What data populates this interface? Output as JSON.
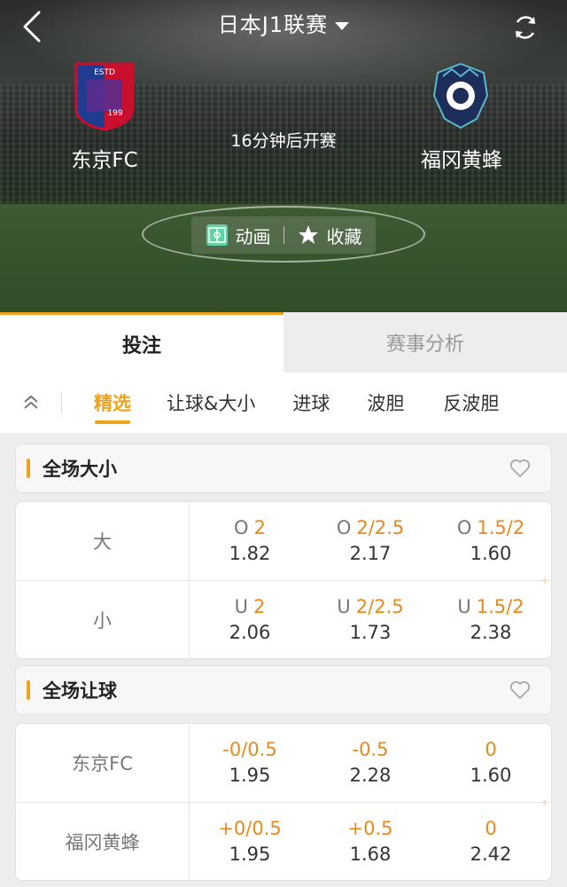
{
  "header": {
    "league": "日本J1联赛",
    "kickoff": "16分钟后开赛",
    "home_team": "东京FC",
    "away_team": "福冈黄蜂",
    "actions": {
      "animation": "动画",
      "favorite": "收藏"
    }
  },
  "main_tabs": [
    "投注",
    "赛事分析"
  ],
  "sub_tabs": [
    "精选",
    "让球&大小",
    "进球",
    "波胆",
    "反波胆"
  ],
  "sections": [
    {
      "title": "全场大小",
      "rows": [
        {
          "label": "大",
          "cells": [
            {
              "prefix": "O",
              "line": "2",
              "price": "1.82"
            },
            {
              "prefix": "O",
              "line": "2/2.5",
              "price": "2.17"
            },
            {
              "prefix": "O",
              "line": "1.5/2",
              "price": "1.60"
            }
          ]
        },
        {
          "label": "小",
          "cells": [
            {
              "prefix": "U",
              "line": "2",
              "price": "2.06"
            },
            {
              "prefix": "U",
              "line": "2/2.5",
              "price": "1.73"
            },
            {
              "prefix": "U",
              "line": "1.5/2",
              "price": "2.38"
            }
          ]
        }
      ]
    },
    {
      "title": "全场让球",
      "rows": [
        {
          "label": "东京FC",
          "cells": [
            {
              "prefix": "",
              "line": "-0/0.5",
              "price": "1.95"
            },
            {
              "prefix": "",
              "line": "-0.5",
              "price": "2.28"
            },
            {
              "prefix": "",
              "line": "0",
              "price": "1.60"
            }
          ]
        },
        {
          "label": "福冈黄蜂",
          "cells": [
            {
              "prefix": "",
              "line": "+0/0.5",
              "price": "1.95"
            },
            {
              "prefix": "",
              "line": "+0.5",
              "price": "1.68"
            },
            {
              "prefix": "",
              "line": "0",
              "price": "2.42"
            }
          ]
        }
      ]
    }
  ],
  "colors": {
    "accent": "#f0a21a",
    "handicap": "#e68a1e"
  }
}
